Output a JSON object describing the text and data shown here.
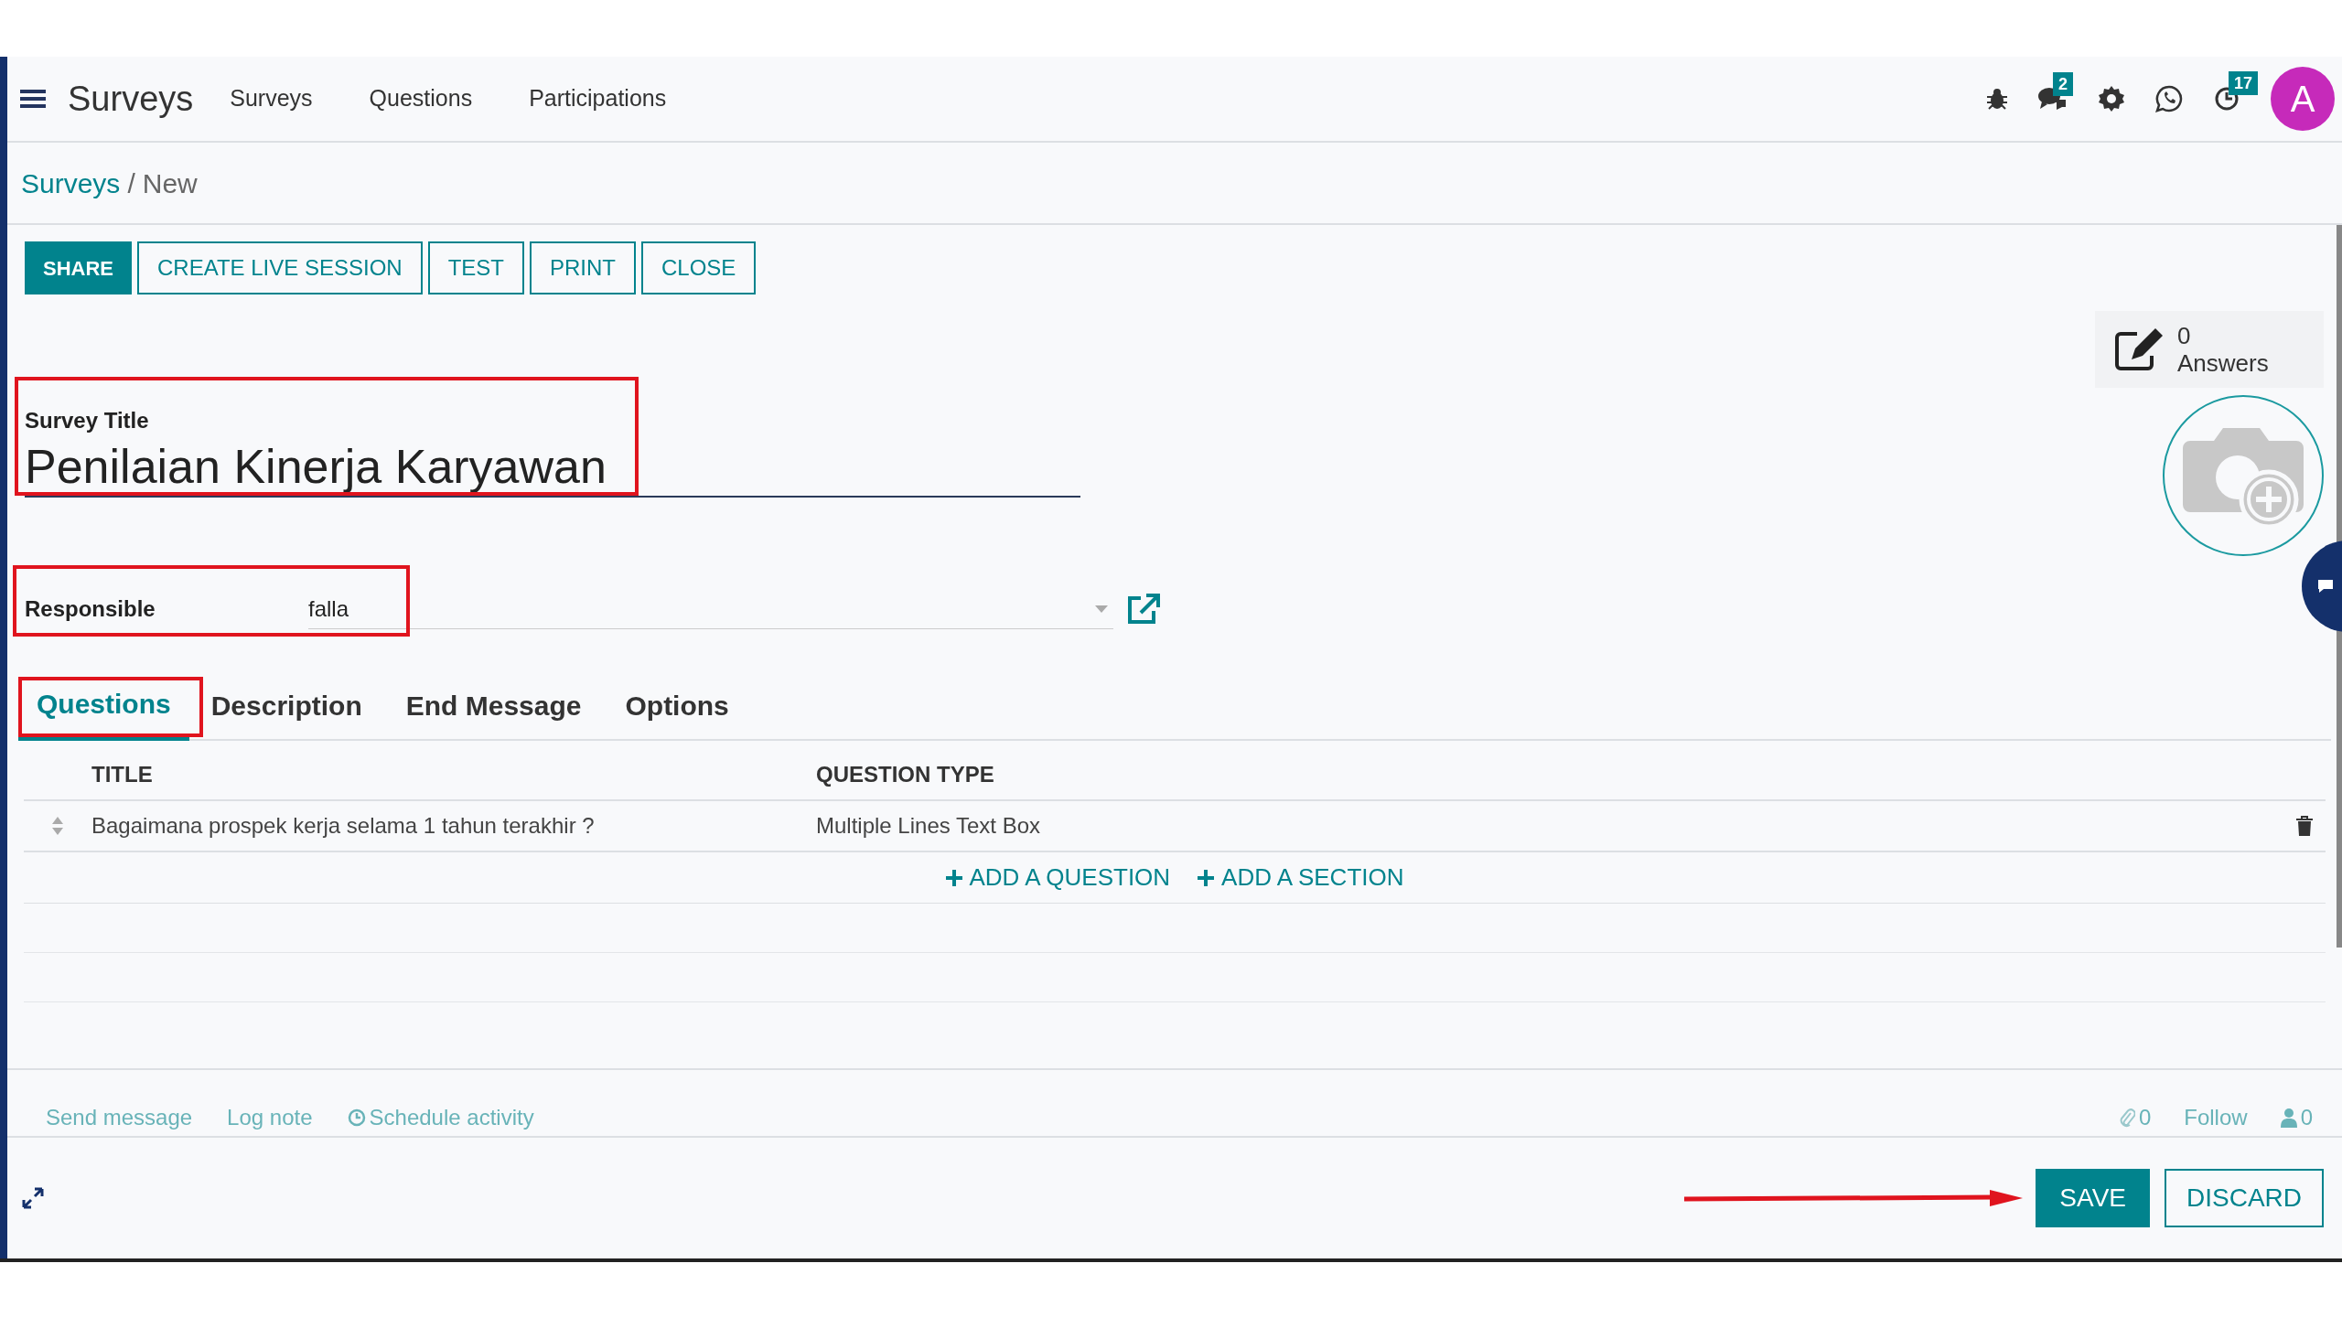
{
  "navbar": {
    "app_title": "Surveys",
    "menu": [
      "Surveys",
      "Questions",
      "Participations"
    ],
    "icons": [
      {
        "kind": "bug"
      },
      {
        "kind": "chat",
        "badge": "2"
      },
      {
        "kind": "gear"
      },
      {
        "kind": "whatsapp"
      },
      {
        "kind": "clock",
        "badge": "17"
      }
    ],
    "avatar": "A"
  },
  "breadcrumb": {
    "link": "Surveys",
    "separator": "/",
    "current": "New"
  },
  "actions": [
    {
      "label": "SHARE",
      "primary": true
    },
    {
      "label": "CREATE LIVE SESSION",
      "primary": false
    },
    {
      "label": "TEST",
      "primary": false
    },
    {
      "label": "PRINT",
      "primary": false
    },
    {
      "label": "CLOSE",
      "primary": false
    }
  ],
  "stat": {
    "value": "0",
    "label": "Answers"
  },
  "form": {
    "title_label": "Survey Title",
    "title_value": "Penilaian Kinerja Karyawan",
    "responsible_label": "Responsible",
    "responsible_value": "falla"
  },
  "tabs": [
    {
      "label": "Questions",
      "selected": true
    },
    {
      "label": "Description",
      "selected": false
    },
    {
      "label": "End Message",
      "selected": false
    },
    {
      "label": "Options",
      "selected": false
    }
  ],
  "table": {
    "columns": [
      "TITLE",
      "QUESTION TYPE"
    ],
    "rows": [
      {
        "title": "Bagaimana prospek kerja selama 1 tahun terakhir ?",
        "type": "Multiple Lines Text Box"
      }
    ],
    "add_links": [
      "ADD A QUESTION",
      "ADD A SECTION"
    ]
  },
  "chatter": {
    "actions": [
      {
        "label": "Send message",
        "kind": "plain"
      },
      {
        "label": "Log note",
        "kind": "plain"
      },
      {
        "label": "Schedule activity",
        "kind": "clock"
      }
    ],
    "attachments": "0",
    "follow": "Follow",
    "followers": "0"
  },
  "footer_buttons": [
    {
      "label": "SAVE",
      "primary": true
    },
    {
      "label": "DISCARD",
      "primary": false
    }
  ]
}
